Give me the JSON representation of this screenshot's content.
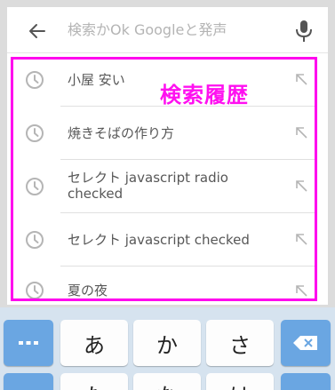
{
  "search": {
    "placeholder": "検索かOk Googleと発声"
  },
  "history": {
    "items": [
      {
        "label": "小屋 安い"
      },
      {
        "label": "焼きそばの作り方"
      },
      {
        "label": "セレクト javascript radio checked"
      },
      {
        "label": "セレクト javascript checked"
      },
      {
        "label": "夏の夜"
      }
    ]
  },
  "annotation": {
    "label": "検索履歴",
    "color": "#ff00ee"
  },
  "keyboard": {
    "row1": [
      "あ",
      "か",
      "さ"
    ],
    "row2_partial": [
      "た",
      "な",
      "は"
    ],
    "accent_color": "#6aa6e2"
  },
  "icons": {
    "back": "arrow-left-icon",
    "mic": "microphone-icon",
    "history": "clock-icon",
    "fill_query": "arrow-up-left-icon",
    "more": "ellipsis-icon",
    "delete": "backspace-icon"
  }
}
